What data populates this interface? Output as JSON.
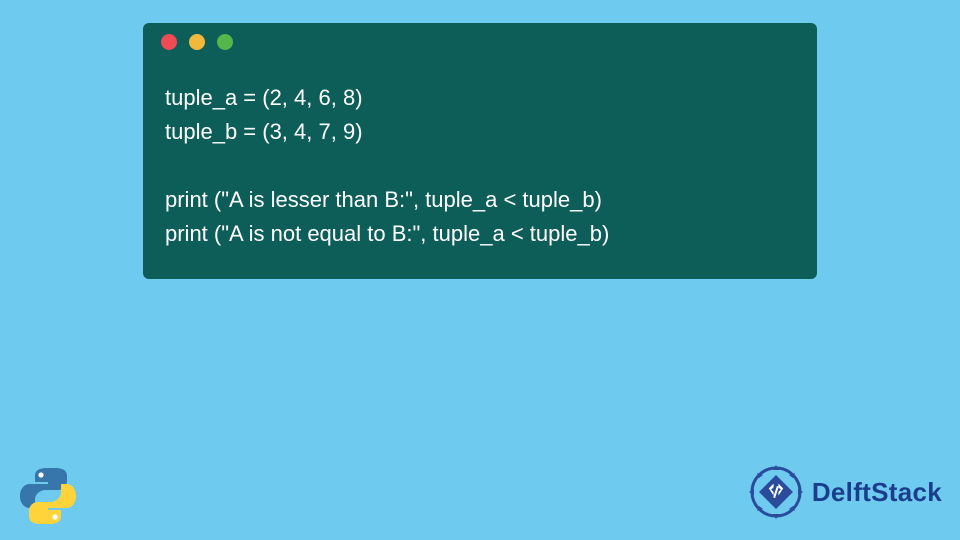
{
  "window": {
    "dots": [
      "red",
      "yellow",
      "green"
    ],
    "code_lines": [
      "tuple_a = (2, 4, 6, 8)",
      "tuple_b = (3, 4, 7, 9)",
      "",
      "print (\"A is lesser than B:\", tuple_a < tuple_b)",
      "print (\"A is not equal to B:\", tuple_a < tuple_b)"
    ]
  },
  "brand": {
    "label": "DelftStack"
  },
  "colors": {
    "bg": "#6ecaee",
    "window": "#0d5e59",
    "brand_text": "#1a3e8c"
  }
}
